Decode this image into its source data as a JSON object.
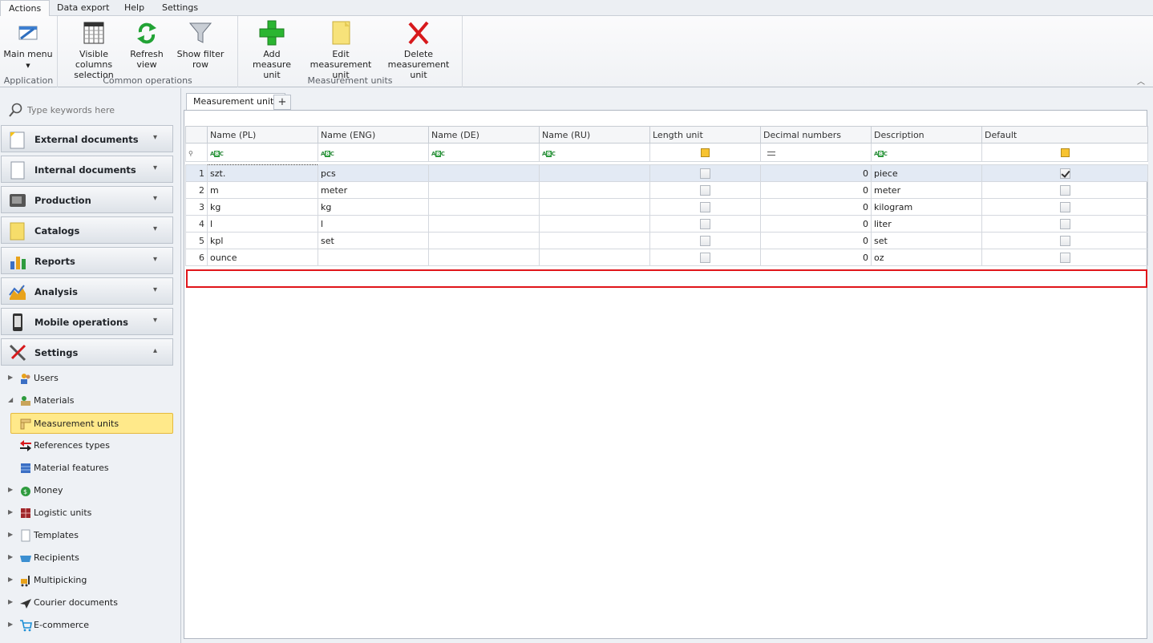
{
  "ribbon": {
    "tabs": [
      "Actions",
      "Data export",
      "Help",
      "Settings"
    ],
    "groups": {
      "application": "Application",
      "common": "Common operations",
      "units": "Measurement units"
    },
    "buttons": {
      "main_menu": "Main menu",
      "visible_columns_1": "Visible columns",
      "visible_columns_2": "selection",
      "refresh_1": "Refresh",
      "refresh_2": "view",
      "show_filter": "Show filter row",
      "add_1": "Add measure",
      "add_2": "unit",
      "edit_1": "Edit measurement",
      "edit_2": "unit",
      "delete_1": "Delete",
      "delete_2": "measurement unit"
    }
  },
  "sidebar": {
    "search_placeholder": "Type keywords here",
    "sections": [
      "External documents",
      "Internal documents",
      "Production",
      "Catalogs",
      "Reports",
      "Analysis",
      "Mobile operations",
      "Settings"
    ],
    "tree": [
      "Users",
      "Materials",
      "Measurement units",
      "References types",
      "Material features",
      "Money",
      "Logistic units",
      "Templates",
      "Recipients",
      "Multipicking",
      "Courier documents",
      "E-commerce"
    ]
  },
  "main": {
    "tab_label": "Measurement units",
    "add_tab_label": "+",
    "columns": [
      "Name (PL)",
      "Name (ENG)",
      "Name (DE)",
      "Name (RU)",
      "Length unit",
      "Decimal numbers",
      "Description",
      "Default"
    ],
    "rows": [
      {
        "num": "1",
        "pl": "szt.",
        "eng": "pcs",
        "de": "",
        "ru": "",
        "length": false,
        "decimals": "0",
        "desc": "piece",
        "default": true
      },
      {
        "num": "2",
        "pl": "m",
        "eng": "meter",
        "de": "",
        "ru": "",
        "length": false,
        "decimals": "0",
        "desc": "meter",
        "default": false
      },
      {
        "num": "3",
        "pl": "kg",
        "eng": "kg",
        "de": "",
        "ru": "",
        "length": false,
        "decimals": "0",
        "desc": "kilogram",
        "default": false
      },
      {
        "num": "4",
        "pl": "l",
        "eng": "l",
        "de": "",
        "ru": "",
        "length": false,
        "decimals": "0",
        "desc": "liter",
        "default": false
      },
      {
        "num": "5",
        "pl": "kpl",
        "eng": "set",
        "de": "",
        "ru": "",
        "length": false,
        "decimals": "0",
        "desc": "set",
        "default": false
      },
      {
        "num": "6",
        "pl": "ounce",
        "eng": "",
        "de": "",
        "ru": "",
        "length": false,
        "decimals": "0",
        "desc": "oz",
        "default": false
      }
    ]
  },
  "colors": {
    "highlight": "#e0151a",
    "selected_nav": "#ffe98a",
    "focused_row": "#e3eaf4"
  }
}
